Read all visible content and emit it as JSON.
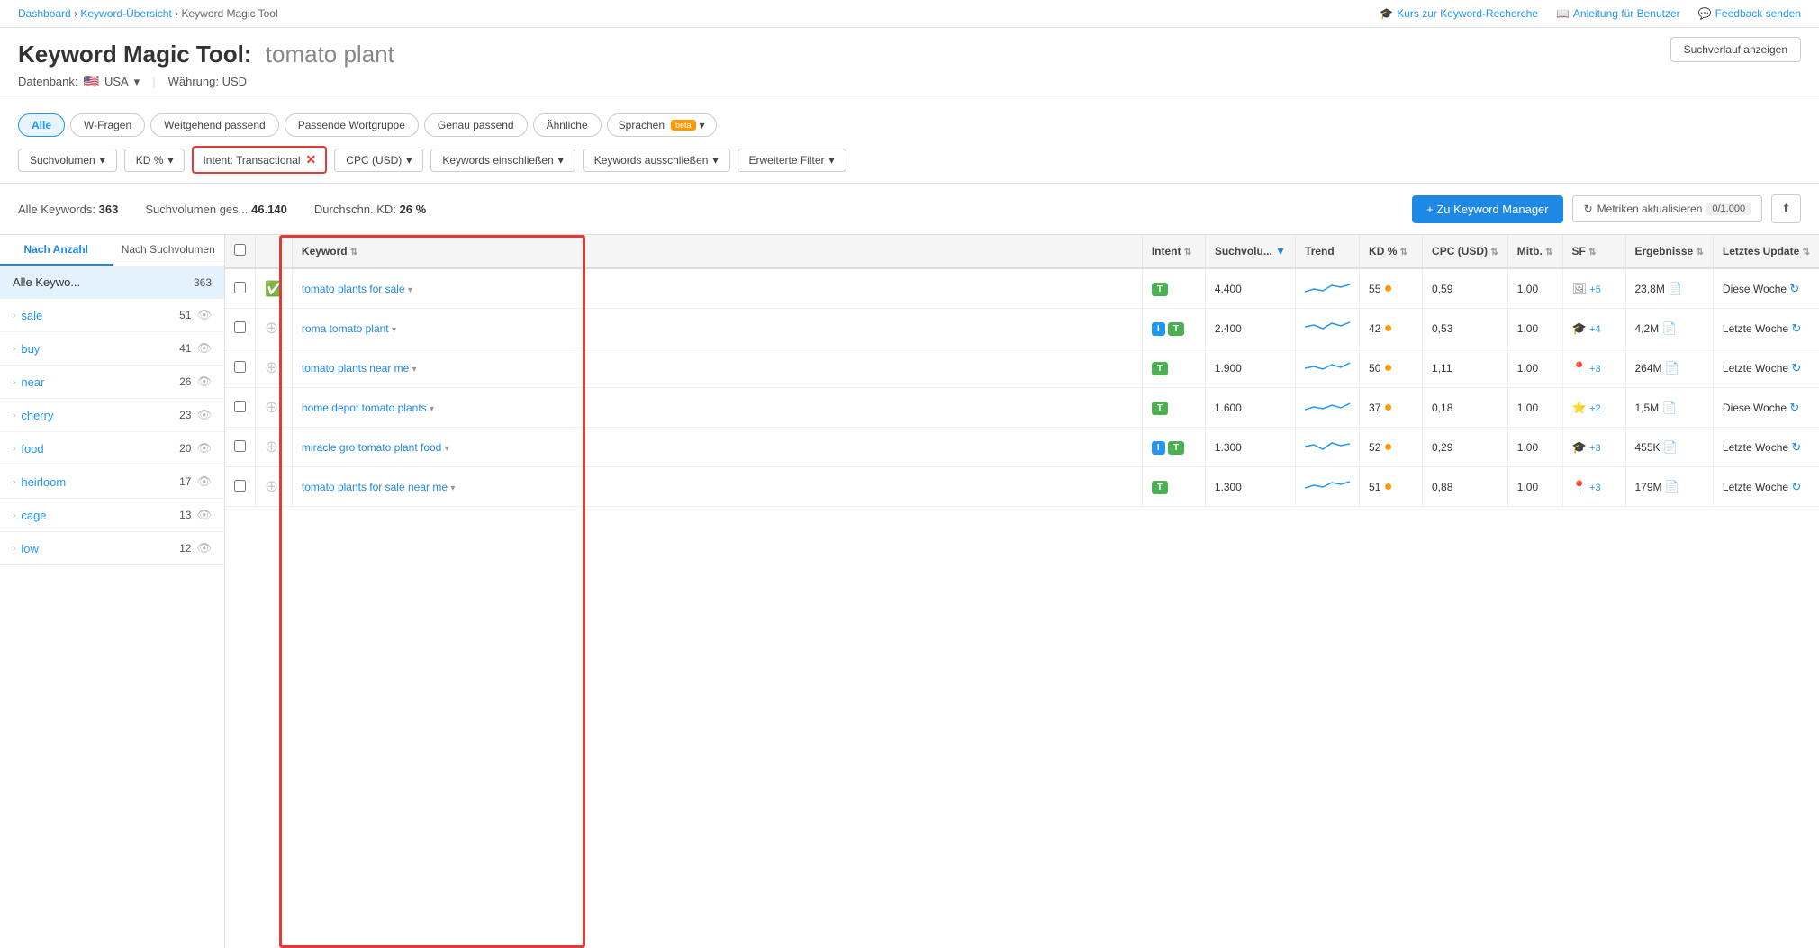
{
  "breadcrumb": {
    "items": [
      "Dashboard",
      "Keyword-Übersicht",
      "Keyword Magic Tool"
    ]
  },
  "top_nav_links": [
    {
      "label": "Kurs zur Keyword-Recherche",
      "icon": "graduation-icon"
    },
    {
      "label": "Anleitung für Benutzer",
      "icon": "book-icon"
    },
    {
      "label": "Feedback senden",
      "icon": "chat-icon"
    }
  ],
  "header": {
    "title_prefix": "Keyword Magic Tool:",
    "title_keyword": "tomato plant",
    "suchverlauf_label": "Suchverlauf anzeigen",
    "subtitle_db": "Datenbank:",
    "subtitle_currency": "Währung: USD",
    "country": "USA"
  },
  "filter_tabs": [
    {
      "label": "Alle",
      "active": true
    },
    {
      "label": "W-Fragen",
      "active": false
    },
    {
      "label": "Weitgehend passend",
      "active": false
    },
    {
      "label": "Passende Wortgruppe",
      "active": false
    },
    {
      "label": "Genau passend",
      "active": false
    },
    {
      "label": "Ähnliche",
      "active": false
    },
    {
      "label": "Sprachen",
      "active": false,
      "beta": true
    }
  ],
  "filter_dropdowns": [
    {
      "label": "Suchvolumen",
      "has_arrow": true
    },
    {
      "label": "KD %",
      "has_arrow": true
    },
    {
      "label": "Intent: Transactional",
      "active_filter": true
    },
    {
      "label": "CPC (USD)",
      "has_arrow": true
    },
    {
      "label": "Keywords einschließen",
      "has_arrow": true
    },
    {
      "label": "Keywords ausschließen",
      "has_arrow": true
    },
    {
      "label": "Erweiterte Filter",
      "has_arrow": true
    }
  ],
  "stats": {
    "all_keywords_label": "Alle Keywords:",
    "all_keywords_value": "363",
    "suchvolumen_label": "Suchvolumen ges...",
    "suchvolumen_value": "46.140",
    "kd_label": "Durchschn. KD:",
    "kd_value": "26 %"
  },
  "buttons": {
    "keyword_manager": "+ Zu Keyword Manager",
    "metriken": "Metriken aktualisieren",
    "metriken_count": "0/1.000"
  },
  "sidebar": {
    "tab1": "Nach Anzahl",
    "tab2": "Nach Suchvolumen",
    "items": [
      {
        "label": "Alle Keywo...",
        "count": 363,
        "all": true,
        "selected": true
      },
      {
        "label": "sale",
        "count": 51
      },
      {
        "label": "buy",
        "count": 41
      },
      {
        "label": "near",
        "count": 26
      },
      {
        "label": "cherry",
        "count": 23
      },
      {
        "label": "food",
        "count": 20
      },
      {
        "label": "heirloom",
        "count": 17
      },
      {
        "label": "cage",
        "count": 13
      },
      {
        "label": "low",
        "count": 12
      }
    ]
  },
  "table": {
    "columns": [
      "",
      "",
      "Keyword",
      "Intent",
      "Suchvolu...",
      "Trend",
      "KD %",
      "CPC (USD)",
      "Mitb.",
      "SF",
      "Ergebnisse",
      "Letztes Update"
    ],
    "rows": [
      {
        "checked": false,
        "check_type": "green",
        "keyword": "tomato plants for sale",
        "keyword_url": "#",
        "intents": [
          "T"
        ],
        "suchvolumen": "4.400",
        "kd": "55",
        "kd_color": "orange",
        "cpc": "0,59",
        "mitb": "1,00",
        "sf_icon": "image",
        "sf_plus": "+5",
        "ergebnisse": "23,8M",
        "update": "Diese Woche",
        "highlighted": true
      },
      {
        "checked": false,
        "check_type": "add",
        "keyword": "roma tomato plant",
        "keyword_url": "#",
        "intents": [
          "I",
          "T"
        ],
        "suchvolumen": "2.400",
        "kd": "42",
        "kd_color": "orange",
        "cpc": "0,53",
        "mitb": "1,00",
        "sf_icon": "graduate",
        "sf_plus": "+4",
        "ergebnisse": "4,2M",
        "update": "Letzte Woche",
        "highlighted": true
      },
      {
        "checked": false,
        "check_type": "add",
        "keyword": "tomato plants near me",
        "keyword_url": "#",
        "intents": [
          "T"
        ],
        "suchvolumen": "1.900",
        "kd": "50",
        "kd_color": "orange",
        "cpc": "1,11",
        "mitb": "1,00",
        "sf_icon": "pin",
        "sf_plus": "+3",
        "ergebnisse": "264M",
        "update": "Letzte Woche",
        "highlighted": true
      },
      {
        "checked": false,
        "check_type": "add",
        "keyword": "home depot tomato plants",
        "keyword_url": "#",
        "intents": [
          "T"
        ],
        "suchvolumen": "1.600",
        "kd": "37",
        "kd_color": "orange",
        "cpc": "0,18",
        "mitb": "1,00",
        "sf_icon": "star",
        "sf_plus": "+2",
        "ergebnisse": "1,5M",
        "update": "Diese Woche",
        "highlighted": true
      },
      {
        "checked": false,
        "check_type": "add",
        "keyword": "miracle gro tomato plant food",
        "keyword_url": "#",
        "intents": [
          "I",
          "T"
        ],
        "suchvolumen": "1.300",
        "kd": "52",
        "kd_color": "orange",
        "cpc": "0,29",
        "mitb": "1,00",
        "sf_icon": "graduate",
        "sf_plus": "+3",
        "ergebnisse": "455K",
        "update": "Letzte Woche",
        "highlighted": true
      },
      {
        "checked": false,
        "check_type": "add",
        "keyword": "tomato plants for sale near me",
        "keyword_url": "#",
        "intents": [
          "T"
        ],
        "suchvolumen": "1.300",
        "kd": "51",
        "kd_color": "orange",
        "cpc": "0,88",
        "mitb": "1,00",
        "sf_icon": "pin",
        "sf_plus": "+3",
        "ergebnisse": "179M",
        "update": "Letzte Woche",
        "highlighted": true
      }
    ]
  }
}
